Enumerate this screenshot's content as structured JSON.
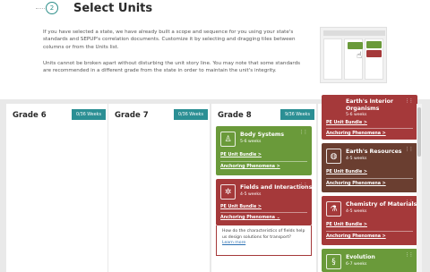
{
  "header": {
    "step": "2",
    "title": "Select Units"
  },
  "intro": {
    "p1": "If you have selected a state, we have already built a scope and sequence for you using your state's standards and SEPUP's correlation documents. Customize it by selecting and dragging tiles between columns or from the Units list.",
    "p2": "Units cannot be broken apart without disturbing the unit story line. You may note that some standards are recommended in a different grade from the state in order to maintain the unit's integrity."
  },
  "columns": [
    {
      "label": "Grade 6",
      "weeks": "0/36 Weeks"
    },
    {
      "label": "Grade 7",
      "weeks": "0/36 Weeks"
    },
    {
      "label": "Grade 8",
      "weeks": "9/36 Weeks"
    }
  ],
  "grade8_cards": [
    {
      "title": "Body Systems",
      "duration": "5-6 weeks",
      "bundle": "PE Unit Bundle  >",
      "phenomena": "Anchoring Phenomena  >",
      "icon": "person-icon",
      "color": "#6a9a3a"
    },
    {
      "title": "Fields and Interactions",
      "duration": "4-5 weeks",
      "bundle": "PE Unit Bundle  >",
      "phenomena": "Anchoring Phenomena  ⌄",
      "icon": "magnet-icon",
      "color": "#a5393a"
    }
  ],
  "popup": {
    "text": "How do the characteristics of fields help us design solutions for transport?",
    "more": "Learn more"
  },
  "units_list": [
    {
      "title": "Earth's Interior",
      "title2": "Organisms",
      "duration": "5-6 weeks",
      "bundle": "PE Unit Bundle  >",
      "phenomena": "Anchoring Phenomena  >",
      "color": "#a5393a"
    },
    {
      "title": "Earth's Resources",
      "duration": "4-5 weeks",
      "bundle": "PE Unit Bundle  >",
      "phenomena": "Anchoring Phenomena  >",
      "color": "#6a3e30",
      "icon": "globe-icon"
    },
    {
      "title": "Chemistry of Materials",
      "duration": "4-5 weeks",
      "bundle": "PE Unit Bundle  >",
      "phenomena": "Anchoring Phenomena  >",
      "color": "#a5393a",
      "icon": "flask-icon"
    },
    {
      "title": "Evolution",
      "duration": "6-7 weeks",
      "color": "#6a9a3a",
      "icon": "dna-icon"
    }
  ]
}
